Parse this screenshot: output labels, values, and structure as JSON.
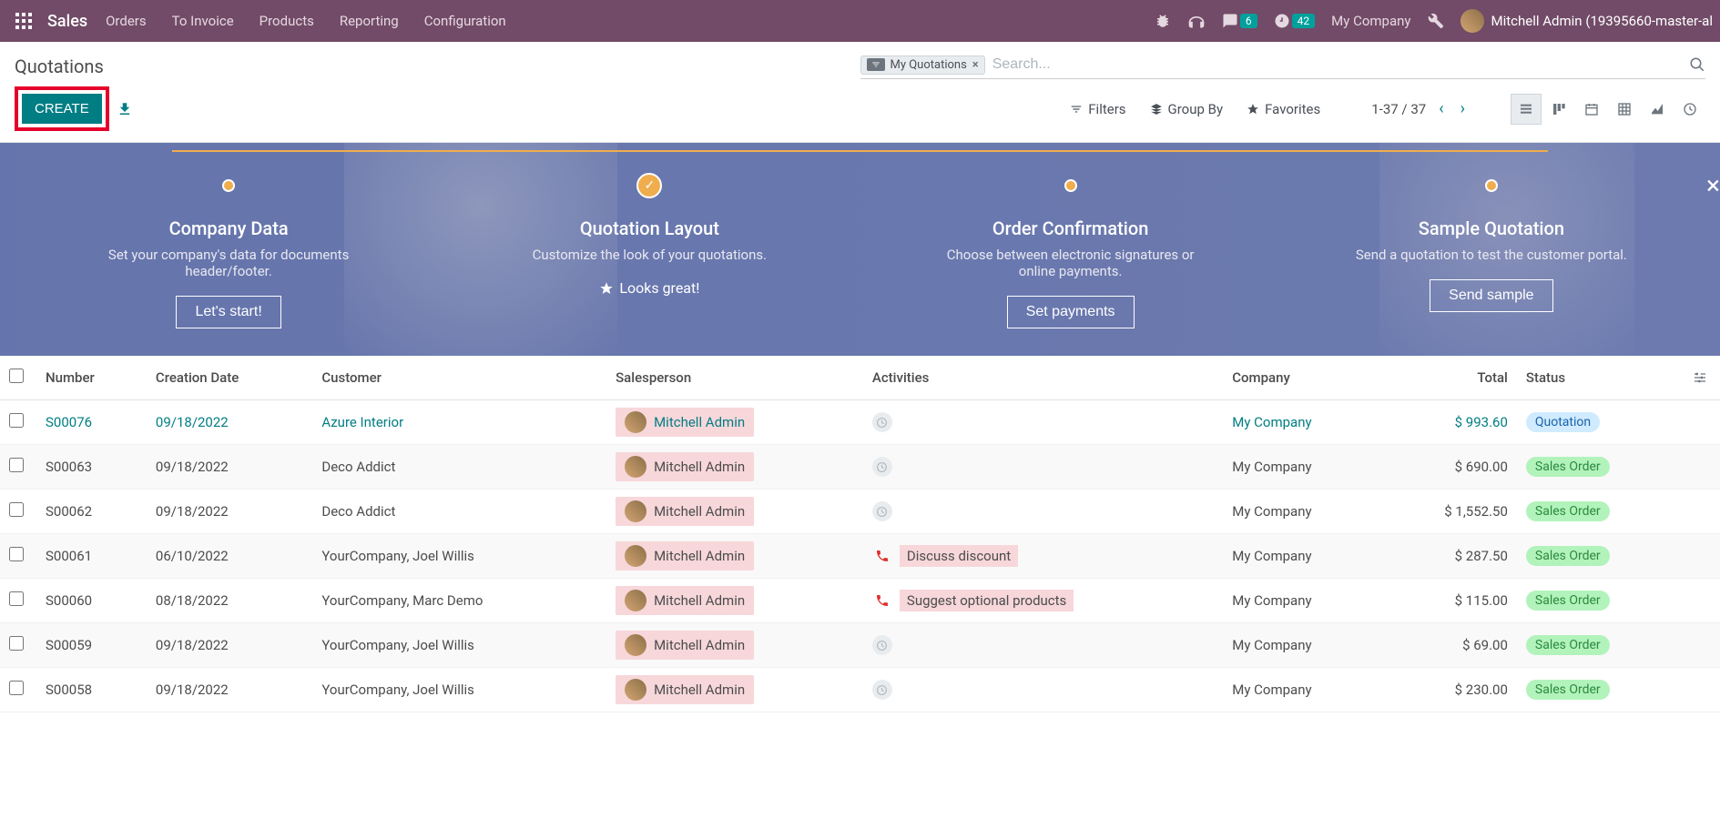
{
  "topbar": {
    "app_title": "Sales",
    "menu": [
      "Orders",
      "To Invoice",
      "Products",
      "Reporting",
      "Configuration"
    ],
    "chat_badge": "6",
    "activity_badge": "42",
    "company": "My Company",
    "user": "Mitchell Admin (19395660-master-al"
  },
  "control_panel": {
    "breadcrumb": "Quotations",
    "create_label": "CREATE",
    "filter_chip": "My Quotations",
    "search_placeholder": "Search...",
    "filters_label": "Filters",
    "groupby_label": "Group By",
    "favorites_label": "Favorites",
    "pager": "1-37 / 37"
  },
  "onboarding": {
    "steps": [
      {
        "title": "Company Data",
        "desc": "Set your company's data for documents header/footer.",
        "button": "Let's start!",
        "done": false
      },
      {
        "title": "Quotation Layout",
        "desc": "Customize the look of your quotations.",
        "button": "Looks great!",
        "done": true
      },
      {
        "title": "Order Confirmation",
        "desc": "Choose between electronic signatures or online payments.",
        "button": "Set payments",
        "done": false
      },
      {
        "title": "Sample Quotation",
        "desc": "Send a quotation to test the customer portal.",
        "button": "Send sample",
        "done": false
      }
    ]
  },
  "table": {
    "headers": {
      "number": "Number",
      "creation_date": "Creation Date",
      "customer": "Customer",
      "salesperson": "Salesperson",
      "activities": "Activities",
      "company": "Company",
      "total": "Total",
      "status": "Status"
    },
    "rows": [
      {
        "number": "S00076",
        "date": "09/18/2022",
        "customer": "Azure Interior",
        "salesperson": "Mitchell Admin",
        "activity_type": "clock",
        "activity_text": "",
        "company": "My Company",
        "total": "$ 993.60",
        "status": "Quotation",
        "highlight": true
      },
      {
        "number": "S00063",
        "date": "09/18/2022",
        "customer": "Deco Addict",
        "salesperson": "Mitchell Admin",
        "activity_type": "clock",
        "activity_text": "",
        "company": "My Company",
        "total": "$ 690.00",
        "status": "Sales Order"
      },
      {
        "number": "S00062",
        "date": "09/18/2022",
        "customer": "Deco Addict",
        "salesperson": "Mitchell Admin",
        "activity_type": "clock",
        "activity_text": "",
        "company": "My Company",
        "total": "$ 1,552.50",
        "status": "Sales Order"
      },
      {
        "number": "S00061",
        "date": "06/10/2022",
        "customer": "YourCompany, Joel Willis",
        "salesperson": "Mitchell Admin",
        "activity_type": "phone",
        "activity_text": "Discuss discount",
        "company": "My Company",
        "total": "$ 287.50",
        "status": "Sales Order"
      },
      {
        "number": "S00060",
        "date": "08/18/2022",
        "customer": "YourCompany, Marc Demo",
        "salesperson": "Mitchell Admin",
        "activity_type": "phone",
        "activity_text": "Suggest optional products",
        "company": "My Company",
        "total": "$ 115.00",
        "status": "Sales Order"
      },
      {
        "number": "S00059",
        "date": "09/18/2022",
        "customer": "YourCompany, Joel Willis",
        "salesperson": "Mitchell Admin",
        "activity_type": "clock",
        "activity_text": "",
        "company": "My Company",
        "total": "$ 69.00",
        "status": "Sales Order"
      },
      {
        "number": "S00058",
        "date": "09/18/2022",
        "customer": "YourCompany, Joel Willis",
        "salesperson": "Mitchell Admin",
        "activity_type": "clock",
        "activity_text": "",
        "company": "My Company",
        "total": "$ 230.00",
        "status": "Sales Order"
      }
    ]
  }
}
